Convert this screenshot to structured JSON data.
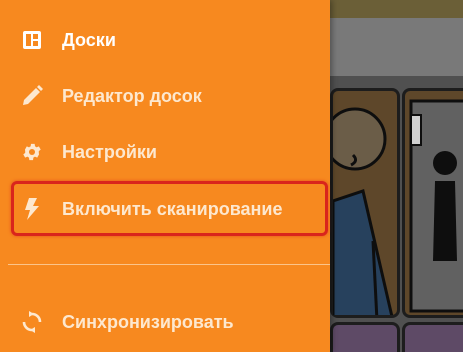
{
  "drawer": {
    "background_color": "#f7891f",
    "highlight_color": "#d9251c",
    "items": [
      {
        "label": "Доски",
        "icon": "boards-icon"
      },
      {
        "label": "Редактор досок",
        "icon": "pencil-icon"
      },
      {
        "label": "Настройки",
        "icon": "gear-icon"
      },
      {
        "label": "Включить сканирование",
        "icon": "lightning-icon",
        "highlighted": true
      },
      {
        "label": "Синхронизировать",
        "icon": "sync-icon"
      }
    ]
  }
}
